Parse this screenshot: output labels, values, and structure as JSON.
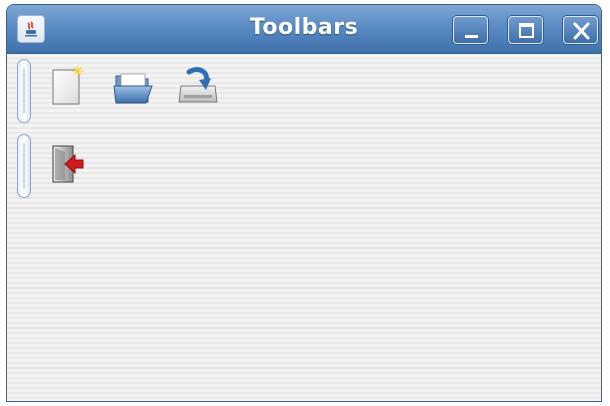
{
  "window": {
    "title": "Toolbars",
    "controls": [
      "minimize",
      "maximize",
      "close"
    ]
  },
  "toolbars": [
    {
      "items": [
        {
          "name": "new",
          "icon": "new-file-icon"
        },
        {
          "name": "open",
          "icon": "folder-open-icon"
        },
        {
          "name": "save",
          "icon": "save-drive-icon"
        }
      ]
    },
    {
      "items": [
        {
          "name": "exit",
          "icon": "exit-door-icon"
        }
      ]
    }
  ],
  "colors": {
    "titlebar": "#4f80bd",
    "title_text": "#ffffff",
    "content_bg": "#efefef",
    "accent_red": "#d11a1a"
  }
}
